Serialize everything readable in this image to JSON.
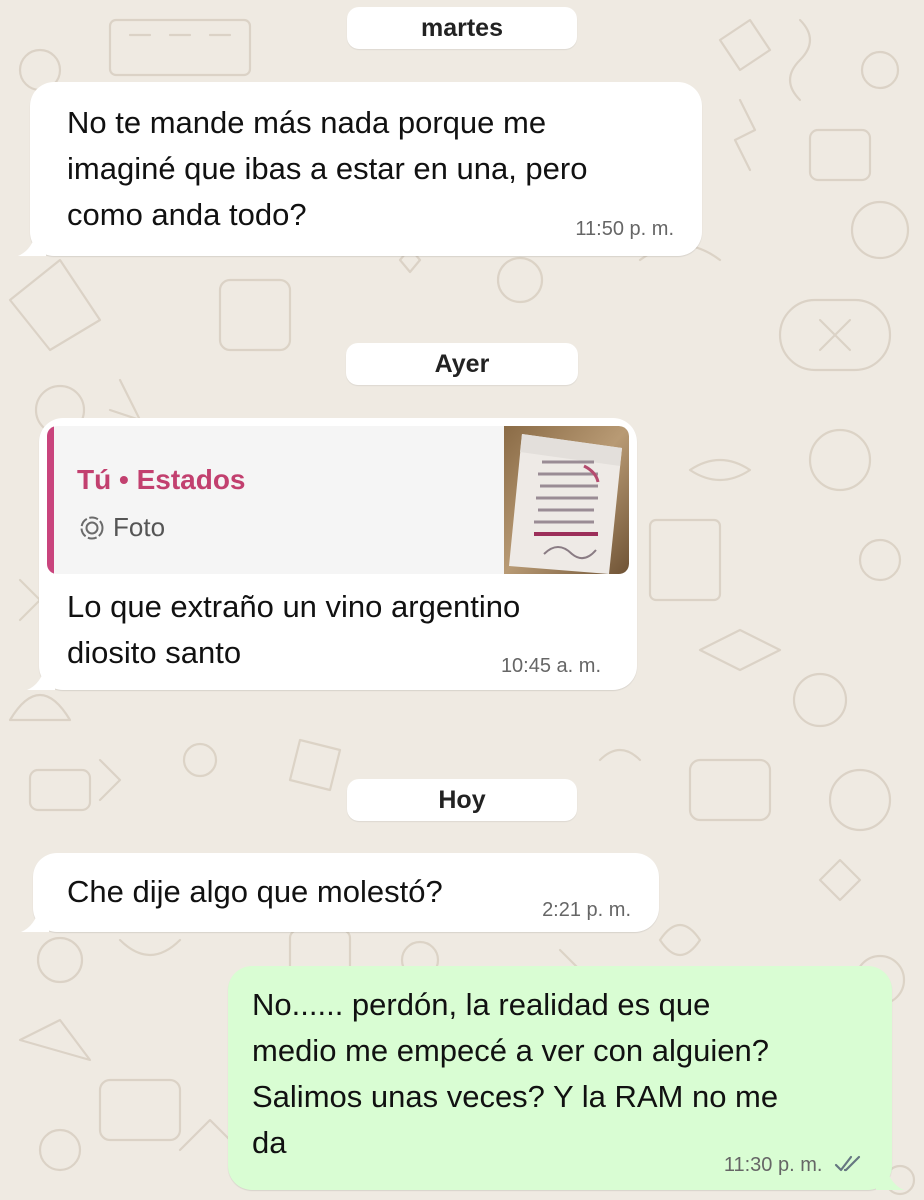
{
  "colors": {
    "background": "#efeae2",
    "incoming_bubble": "#ffffff",
    "outgoing_bubble": "#d9fdd3",
    "quote_accent": "#c9447d"
  },
  "dates": {
    "tuesday": "martes",
    "yesterday": "Ayer",
    "today": "Hoy"
  },
  "messages": [
    {
      "direction": "in",
      "text": "No te mande más nada porque me\nimaginé que ibas a estar en una, pero\ncomo anda todo?",
      "time": "11:50 p. m."
    },
    {
      "direction": "in",
      "quote": {
        "author": "Tú • Estados",
        "type": "Foto",
        "icon": "status-icon"
      },
      "text": "Lo que extraño un vino argentino\ndiosito santo",
      "time": "10:45 a. m."
    },
    {
      "direction": "in",
      "text": "Che dije algo que molestó?",
      "time": "2:21 p. m."
    },
    {
      "direction": "out",
      "text": "No...... perdón, la realidad es que\nmedio me empecé a ver con alguien?\nSalimos unas veces? Y la RAM no me\nda",
      "time": "11:30 p. m.",
      "status_icon": "double-check-icon"
    }
  ]
}
